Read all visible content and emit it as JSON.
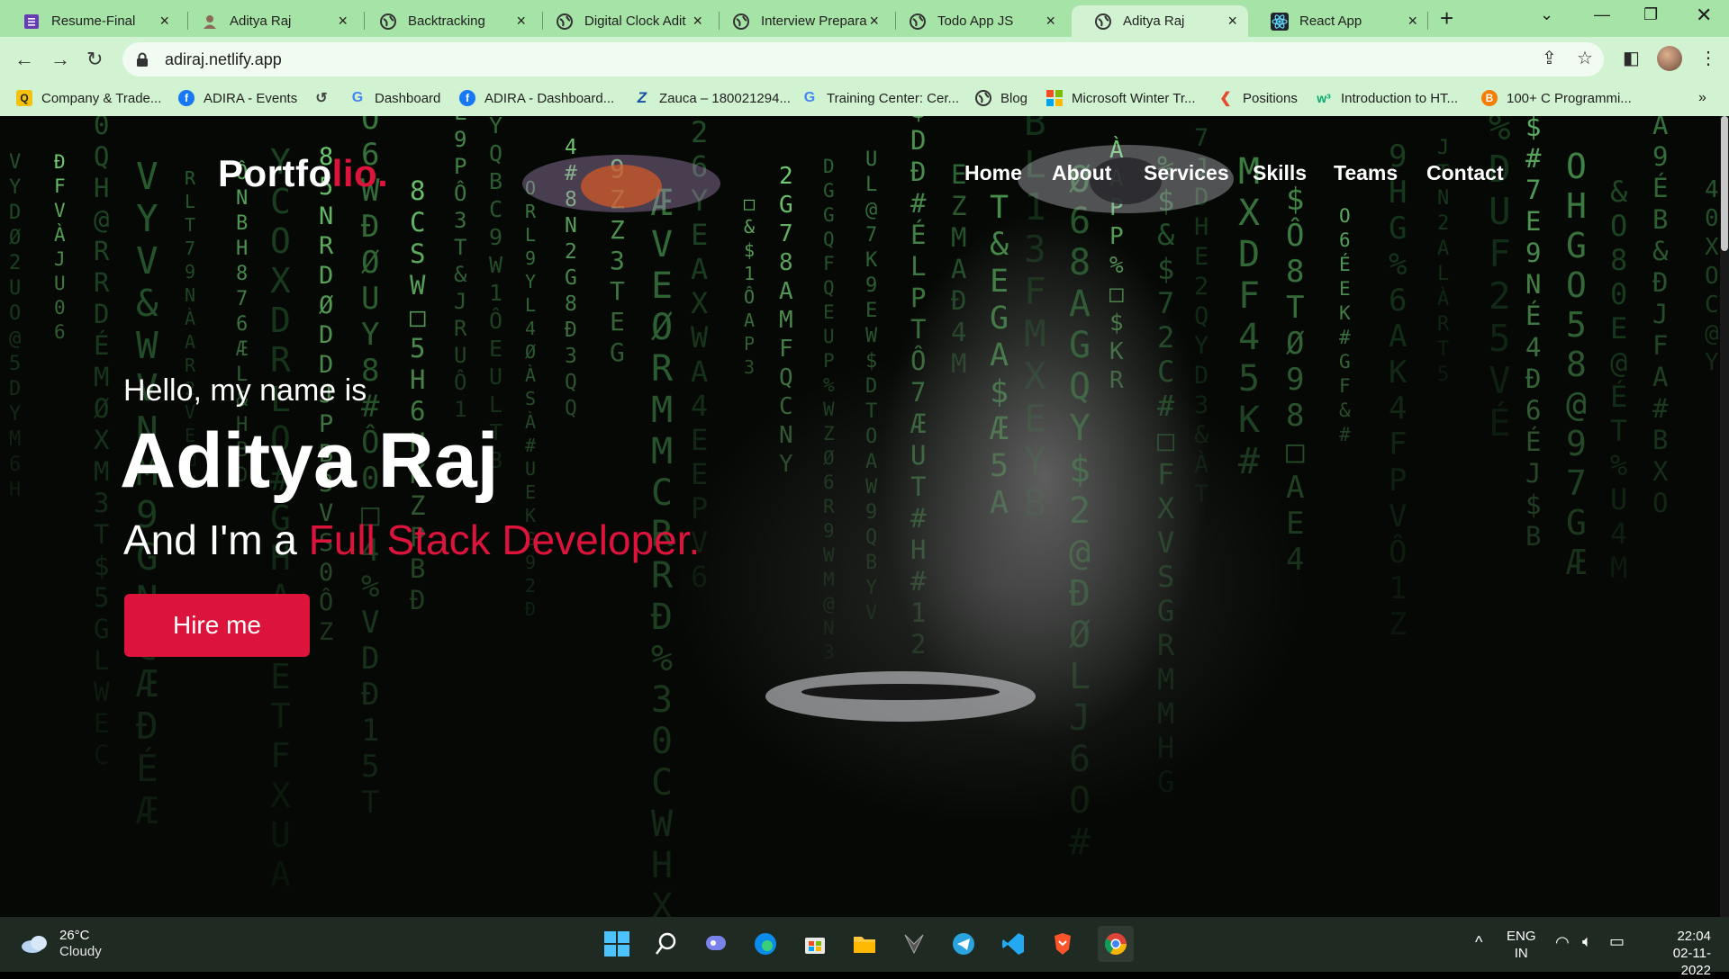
{
  "browser": {
    "tabs": [
      {
        "label": "Resume-Final",
        "icon": "forms-icon",
        "color": "#673ab7"
      },
      {
        "label": "Aditya Raj",
        "icon": "person-icon",
        "color": "#8a6a5a"
      },
      {
        "label": "Backtracking",
        "icon": "globe-icon",
        "color": "#333333"
      },
      {
        "label": "Digital Clock Adit",
        "icon": "globe-icon",
        "color": "#333333"
      },
      {
        "label": "Interview Prepara",
        "icon": "globe-icon",
        "color": "#333333"
      },
      {
        "label": "Todo App JS",
        "icon": "globe-icon",
        "color": "#333333"
      },
      {
        "label": "Aditya Raj",
        "icon": "globe-icon",
        "color": "#333333"
      },
      {
        "label": "React App",
        "icon": "react-icon",
        "color": "#61dafb"
      }
    ],
    "active_tab": 6,
    "url": "adiraj.netlify.app",
    "bookmarks": [
      {
        "label": "Company & Trade...",
        "icon": "q-icon",
        "color": "#f4c20d"
      },
      {
        "label": "ADIRA - Events",
        "icon": "facebook-icon",
        "color": "#1877f2"
      },
      {
        "label": "",
        "icon": "history-icon",
        "color": "#444444"
      },
      {
        "label": "Dashboard",
        "icon": "google-icon",
        "color": "#4285f4"
      },
      {
        "label": "ADIRA - Dashboard...",
        "icon": "facebook-icon",
        "color": "#1877f2"
      },
      {
        "label": "Zauca – 180021294...",
        "icon": "z-icon",
        "color": "#1a4fa0"
      },
      {
        "label": "Training Center: Cer...",
        "icon": "google-icon",
        "color": "#4285f4"
      },
      {
        "label": "Blog",
        "icon": "globe-icon",
        "color": "#333333"
      },
      {
        "label": "Microsoft Winter Tr...",
        "icon": "microsoft-icon",
        "color": "#f25022"
      },
      {
        "label": "Positions",
        "icon": "codeforces-icon",
        "color": "#e8482c"
      },
      {
        "label": "Introduction to HT...",
        "icon": "w3-icon",
        "color": "#04aa6d"
      },
      {
        "label": "100+ C Programmi...",
        "icon": "blogger-icon",
        "color": "#f57d00"
      }
    ]
  },
  "site": {
    "logo_main": "Portfo",
    "logo_accent": "lio.",
    "nav": [
      "Home",
      "About",
      "Services",
      "Skills",
      "Teams",
      "Contact"
    ],
    "hello": "Hello, my name is",
    "name": "Aditya Raj",
    "role_prefix": "And I'm a ",
    "role": "Full Stack Developer.",
    "cta": "Hire me",
    "accent_color": "#dc143c"
  },
  "taskbar": {
    "temperature": "26°C",
    "condition": "Cloudy",
    "language": "ENG",
    "region": "IN",
    "time": "22:04",
    "date": "02-11-2022",
    "apps": [
      "windows-start-icon",
      "search-icon",
      "chat-icon",
      "edge-icon",
      "store-icon",
      "file-explorer-icon",
      "gaming-icon",
      "telegram-icon",
      "vscode-icon",
      "brave-icon",
      "chrome-icon"
    ]
  }
}
